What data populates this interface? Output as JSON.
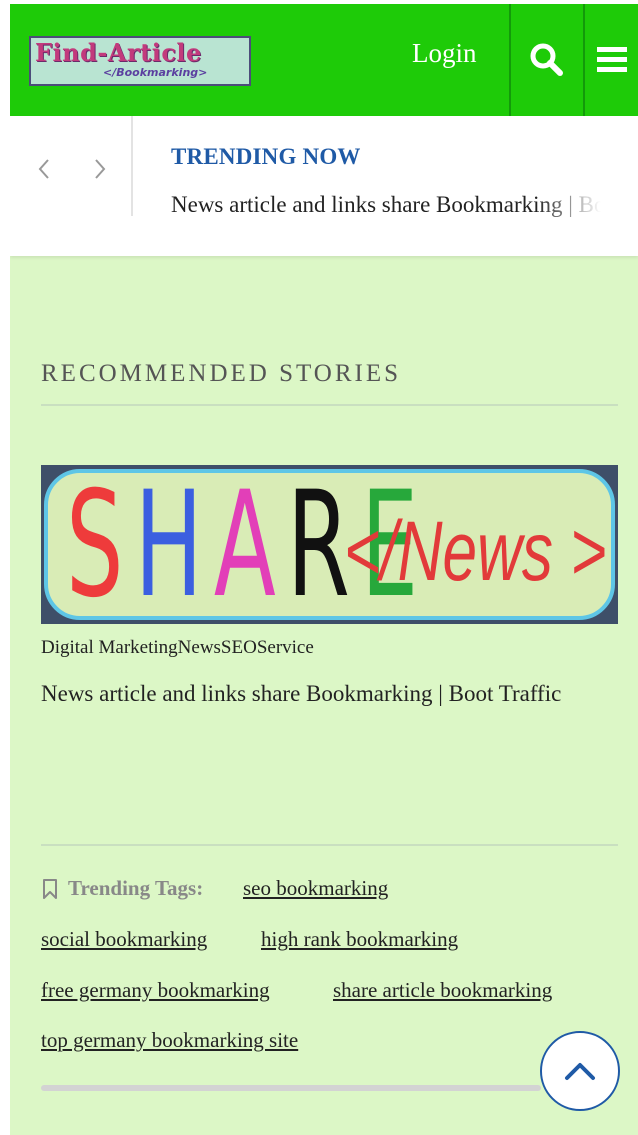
{
  "header": {
    "logo_main": "Find-Article",
    "logo_sub": "</Bookmarking>",
    "login_label": "Login",
    "search_icon": "search-icon",
    "menu_icon": "hamburger-menu-icon",
    "brand_color": "#1ecb08"
  },
  "trending": {
    "prev_icon": "chevron-left-icon",
    "next_icon": "chevron-right-icon",
    "label": "TRENDING NOW",
    "headline": "News article and links share Bookmarking | Boot Traffic",
    "label_color": "#1f5aa6"
  },
  "recommended": {
    "title": "RECOMMENDED STORIES",
    "story": {
      "image_letters": [
        "S",
        "H",
        "A",
        "R",
        "E"
      ],
      "image_letter_colors": [
        "#ee3b3b",
        "#3b5fe0",
        "#e23fb8",
        "#111111",
        "#27a83b"
      ],
      "image_suffix": "</News >",
      "categories": "Digital MarketingNewsSEOService",
      "title": "News article and links share Bookmarking | Boot Traffic"
    }
  },
  "tags": {
    "icon": "bookmark-icon",
    "heading": "Trending Tags:",
    "items": [
      "seo bookmarking",
      "social bookmarking",
      "high rank bookmarking",
      "free germany bookmarking",
      "share article bookmarking",
      "top germany bookmarking site"
    ]
  },
  "controls": {
    "scroll_top_icon": "chevron-up-icon"
  },
  "colors": {
    "page_background": "#dcf7c6",
    "accent_blue": "#1f5aa6"
  }
}
